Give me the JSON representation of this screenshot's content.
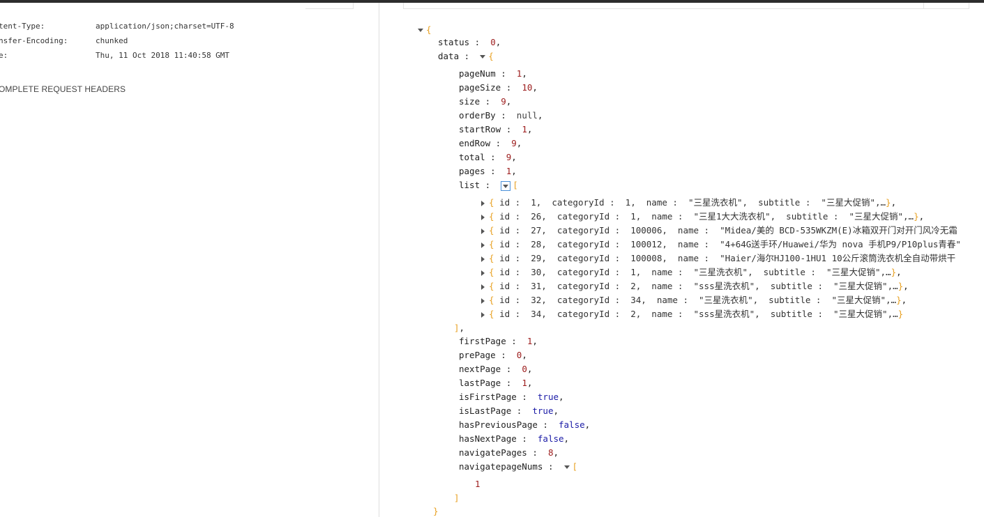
{
  "response_headers": [
    {
      "key": "tent-Type:",
      "value": "application/json;charset=UTF-8"
    },
    {
      "key": "nsfer-Encoding:",
      "value": "chunked"
    },
    {
      "key": "e:",
      "value": "Thu, 11 Oct 2018 11:40:58 GMT"
    }
  ],
  "complete_headers_link": "OMPLETE REQUEST HEADERS",
  "json": {
    "open_brace": "{",
    "close_brace": "}",
    "status_key": "status",
    "status_val": "0",
    "data_key": "data",
    "fields_top": [
      {
        "key": "pageNum",
        "val": "1",
        "type": "num"
      },
      {
        "key": "pageSize",
        "val": "10",
        "type": "num"
      },
      {
        "key": "size",
        "val": "9",
        "type": "num"
      },
      {
        "key": "orderBy",
        "val": "null",
        "type": "nul"
      },
      {
        "key": "startRow",
        "val": "1",
        "type": "num"
      },
      {
        "key": "endRow",
        "val": "9",
        "type": "num"
      },
      {
        "key": "total",
        "val": "9",
        "type": "num"
      },
      {
        "key": "pages",
        "val": "1",
        "type": "num"
      }
    ],
    "list_key": "list",
    "list_items": [
      "id :  1,  categoryId :  1,  name :  \"三星洗衣机\",  subtitle :  \"三星大促销\",…",
      "id :  26,  categoryId :  1,  name :  \"三星1大大洗衣机\",  subtitle :  \"三星大促销\",…",
      "id :  27,  categoryId :  100006,  name :  \"Midea/美的 BCD-535WKZM(E)冰箱双开门对开门风冷无霜",
      "id :  28,  categoryId :  100012,  name :  \"4+64G送手环/Huawei/华为 nova 手机P9/P10plus青春\"",
      "id :  29,  categoryId :  100008,  name :  \"Haier/海尔HJ100-1HU1 10公斤滚筒洗衣机全自动带烘干",
      "id :  30,  categoryId :  1,  name :  \"三星洗衣机\",  subtitle :  \"三星大促销\",…",
      "id :  31,  categoryId :  2,  name :  \"sss星洗衣机\",  subtitle :  \"三星大促销\",…",
      "id :  32,  categoryId :  34,  name :  \"三星洗衣机\",  subtitle :  \"三星大促销\",…",
      "id :  34,  categoryId :  2,  name :  \"sss星洗衣机\",  subtitle :  \"三星大促销\",…"
    ],
    "fields_bottom": [
      {
        "key": "firstPage",
        "val": "1",
        "type": "num"
      },
      {
        "key": "prePage",
        "val": "0",
        "type": "num"
      },
      {
        "key": "nextPage",
        "val": "0",
        "type": "num"
      },
      {
        "key": "lastPage",
        "val": "1",
        "type": "num"
      },
      {
        "key": "isFirstPage",
        "val": "true",
        "type": "bool"
      },
      {
        "key": "isLastPage",
        "val": "true",
        "type": "bool"
      },
      {
        "key": "hasPreviousPage",
        "val": "false",
        "type": "bool"
      },
      {
        "key": "hasNextPage",
        "val": "false",
        "type": "bool"
      },
      {
        "key": "navigatePages",
        "val": "8",
        "type": "num"
      }
    ],
    "navigatepageNums_key": "navigatepageNums",
    "navigatepageNums_values": [
      "1"
    ]
  },
  "colors": {
    "number": "#9c1b1b",
    "boolean": "#1a1aa6",
    "bracket": "#e8a020",
    "topbar": "#2d2d2d"
  }
}
